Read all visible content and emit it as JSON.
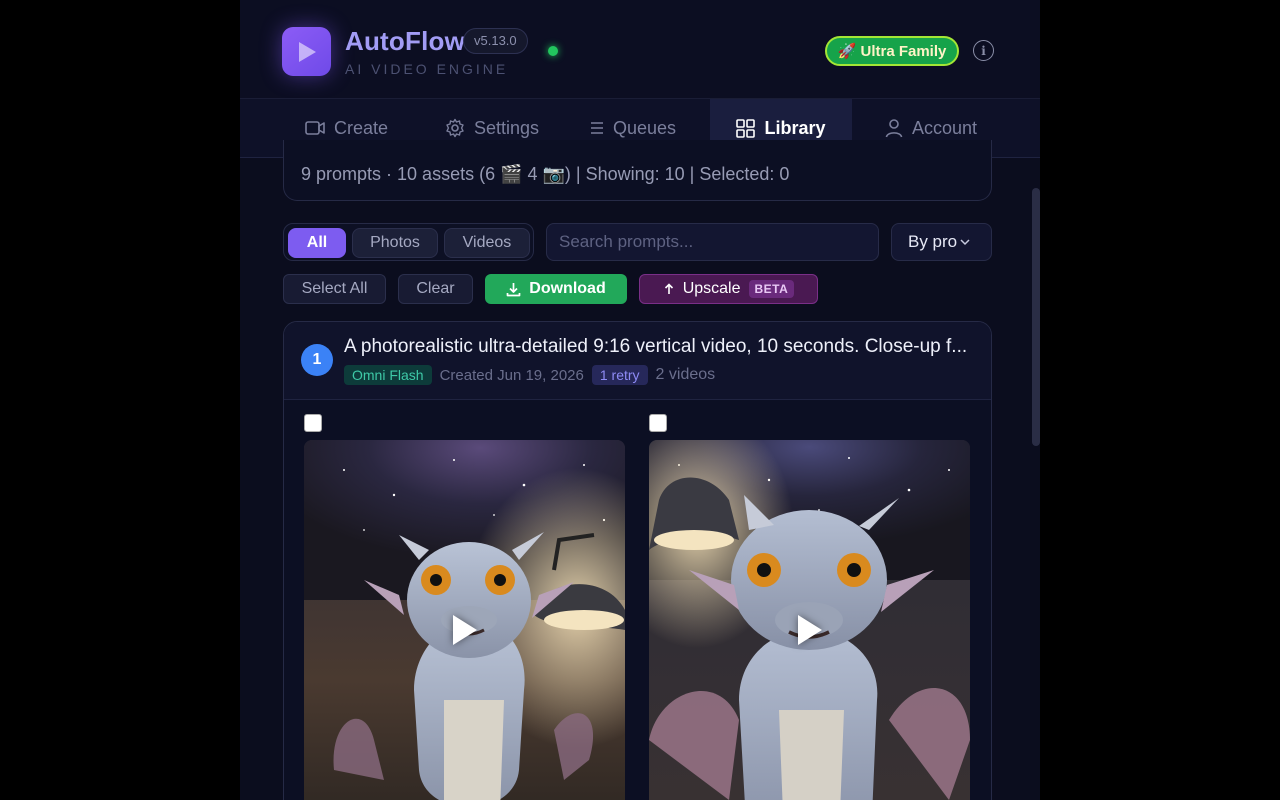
{
  "header": {
    "app_name": "AutoFlow",
    "version": "v5.13.0",
    "subtitle": "AI VIDEO ENGINE",
    "plan_badge": "🚀 Ultra Family",
    "status_color": "#22c55e",
    "accent_color": "#8b6cf6"
  },
  "nav": {
    "tabs": [
      {
        "label": "Create",
        "icon": "video-camera-icon",
        "active": false
      },
      {
        "label": "Settings",
        "icon": "gear-icon",
        "active": false
      },
      {
        "label": "Queues",
        "icon": "list-icon",
        "active": false
      },
      {
        "label": "Library",
        "icon": "grid-icon",
        "active": true
      },
      {
        "label": "Account",
        "icon": "user-icon",
        "active": false
      }
    ]
  },
  "stats": {
    "text": "9 prompts · 10 assets (6 🎬 4 📷) | Showing: 10 | Selected: 0"
  },
  "filters": {
    "segments": [
      "All",
      "Photos",
      "Videos"
    ],
    "active_segment": "All",
    "search_placeholder": "Search prompts...",
    "sort_label": "By pro"
  },
  "actions": {
    "select_all": "Select All",
    "clear": "Clear",
    "download": "Download",
    "upscale": "Upscale",
    "beta": "BETA"
  },
  "prompt_card": {
    "index": "1",
    "prompt": "A photorealistic ultra-detailed 9:16 vertical video, 10 seconds. Close-up f...",
    "model": "Omni Flash",
    "created": "Created Jun 19, 2026",
    "retry": "1 retry",
    "asset_count": "2 videos",
    "assets": [
      {
        "type": "video",
        "selected": false
      },
      {
        "type": "video",
        "selected": false
      }
    ]
  }
}
